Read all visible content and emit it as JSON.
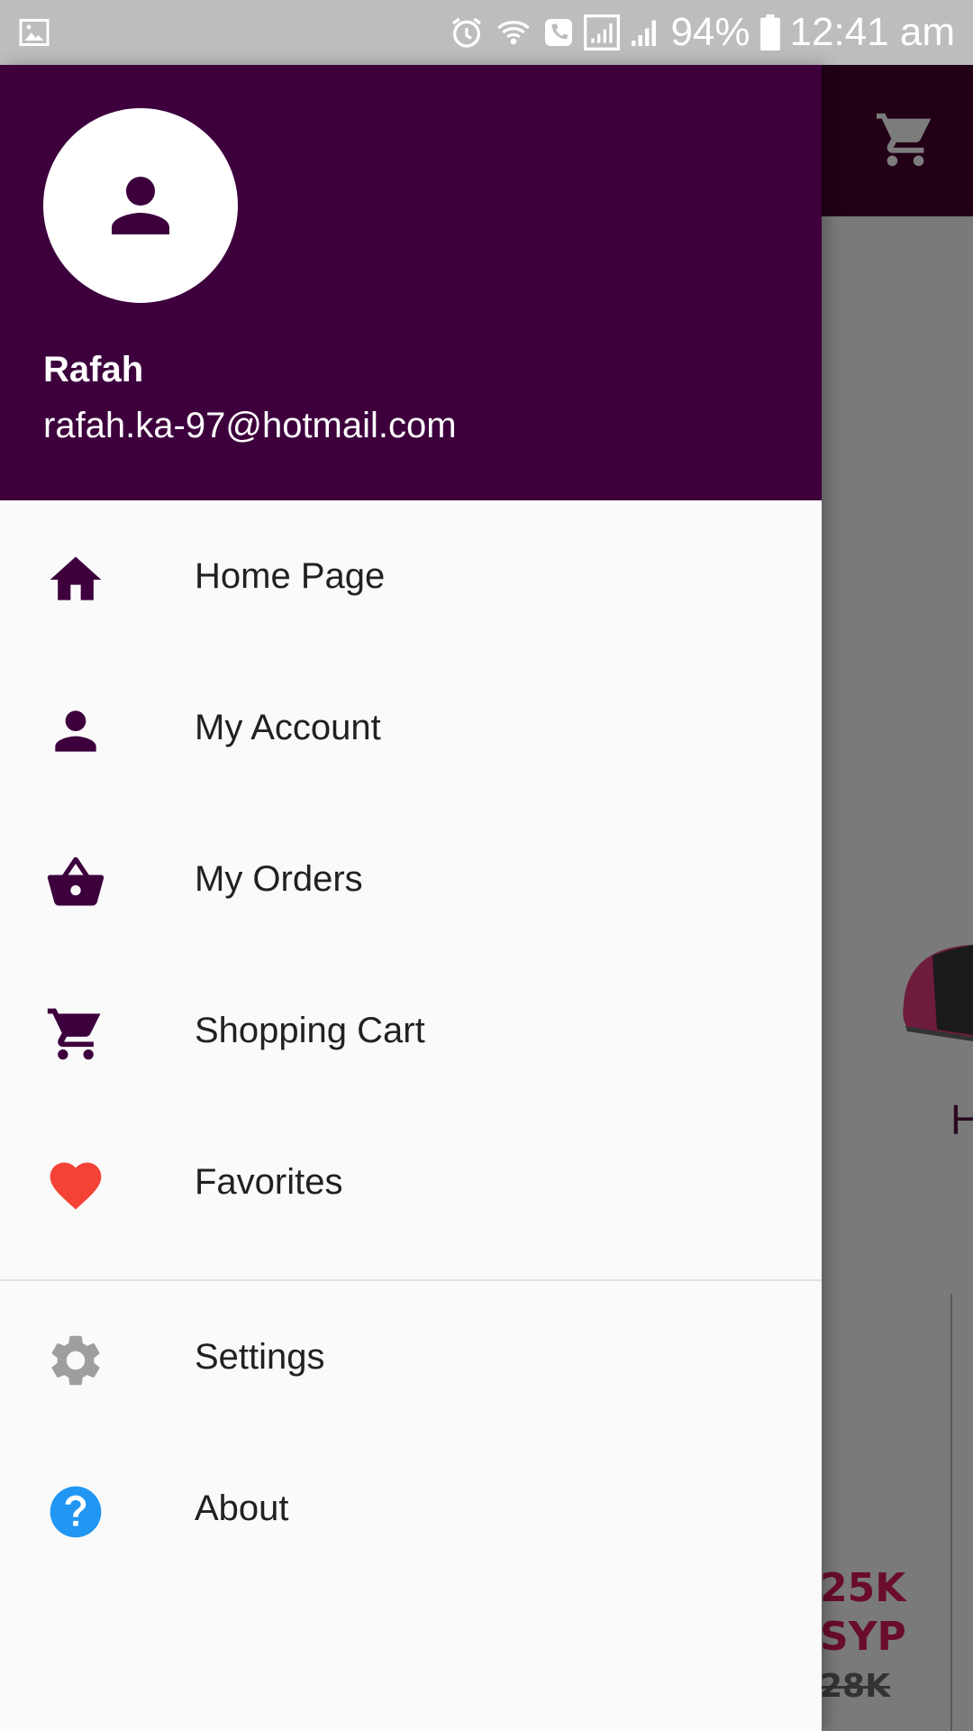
{
  "status_bar": {
    "battery": "94%",
    "time": "12:41 am",
    "icons": [
      "gallery-icon",
      "alarm-icon",
      "wifi-calling-icon",
      "call-icon",
      "signal-icon",
      "signal-icon-2",
      "battery-icon"
    ]
  },
  "drawer": {
    "user": {
      "name": "Rafah",
      "email": "rafah.ka-97@hotmail.com"
    },
    "items": [
      {
        "label": "Home Page",
        "icon": "home-icon"
      },
      {
        "label": "My Account",
        "icon": "person-icon"
      },
      {
        "label": "My Orders",
        "icon": "basket-icon"
      },
      {
        "label": "Shopping Cart",
        "icon": "cart-icon"
      },
      {
        "label": "Favorites",
        "icon": "heart-icon"
      }
    ],
    "secondary_items": [
      {
        "label": "Settings",
        "icon": "gear-icon"
      },
      {
        "label": "About",
        "icon": "help-icon"
      }
    ]
  },
  "background": {
    "letter": "H",
    "price": "25K SYP",
    "price_line1": "25K",
    "price_line2": "SYP",
    "old_price": "28K"
  },
  "colors": {
    "drawer_header": "#3d003d",
    "icon": "#3d003d",
    "heart": "#f44336",
    "gear": "#9e9e9e",
    "help": "#2196f3",
    "price": "#6a0c2e"
  }
}
